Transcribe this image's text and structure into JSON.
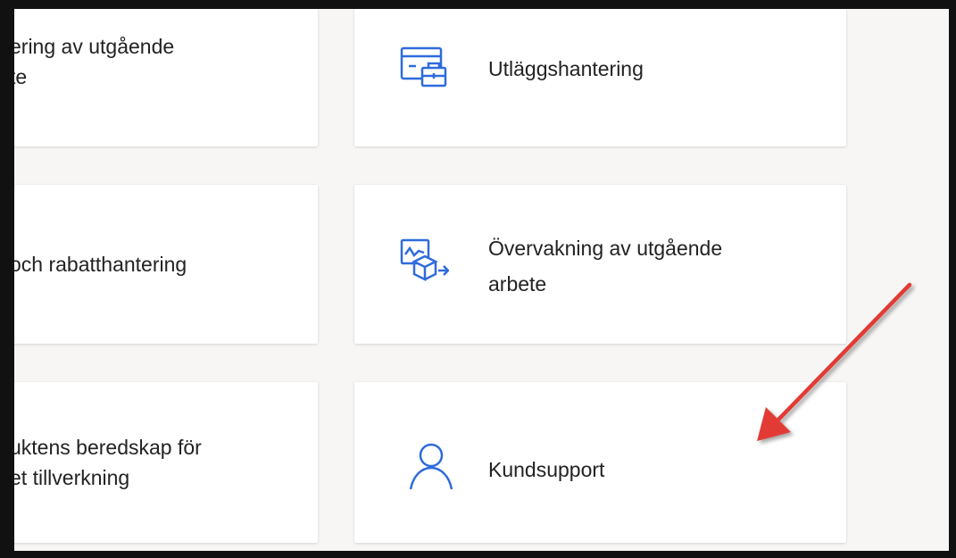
{
  "tiles_left": [
    {
      "line1": "ering av utgående",
      "line2": "te"
    },
    {
      "line1": "och rabatthantering",
      "line2": ""
    },
    {
      "line1": "uktens beredskap för",
      "line2": "et tillverkning"
    }
  ],
  "tiles_right": [
    {
      "line1": "Utläggshantering",
      "line2": "",
      "icon": "expense-card-icon"
    },
    {
      "line1": "Övervakning av utgående",
      "line2": "arbete",
      "icon": "outbound-monitor-icon"
    },
    {
      "line1": "Kundsupport",
      "line2": "",
      "icon": "person-icon"
    }
  ],
  "colors": {
    "icon_blue": "#2f6bdc",
    "arrow_red": "#e23b35",
    "background": "#f7f6f5"
  }
}
